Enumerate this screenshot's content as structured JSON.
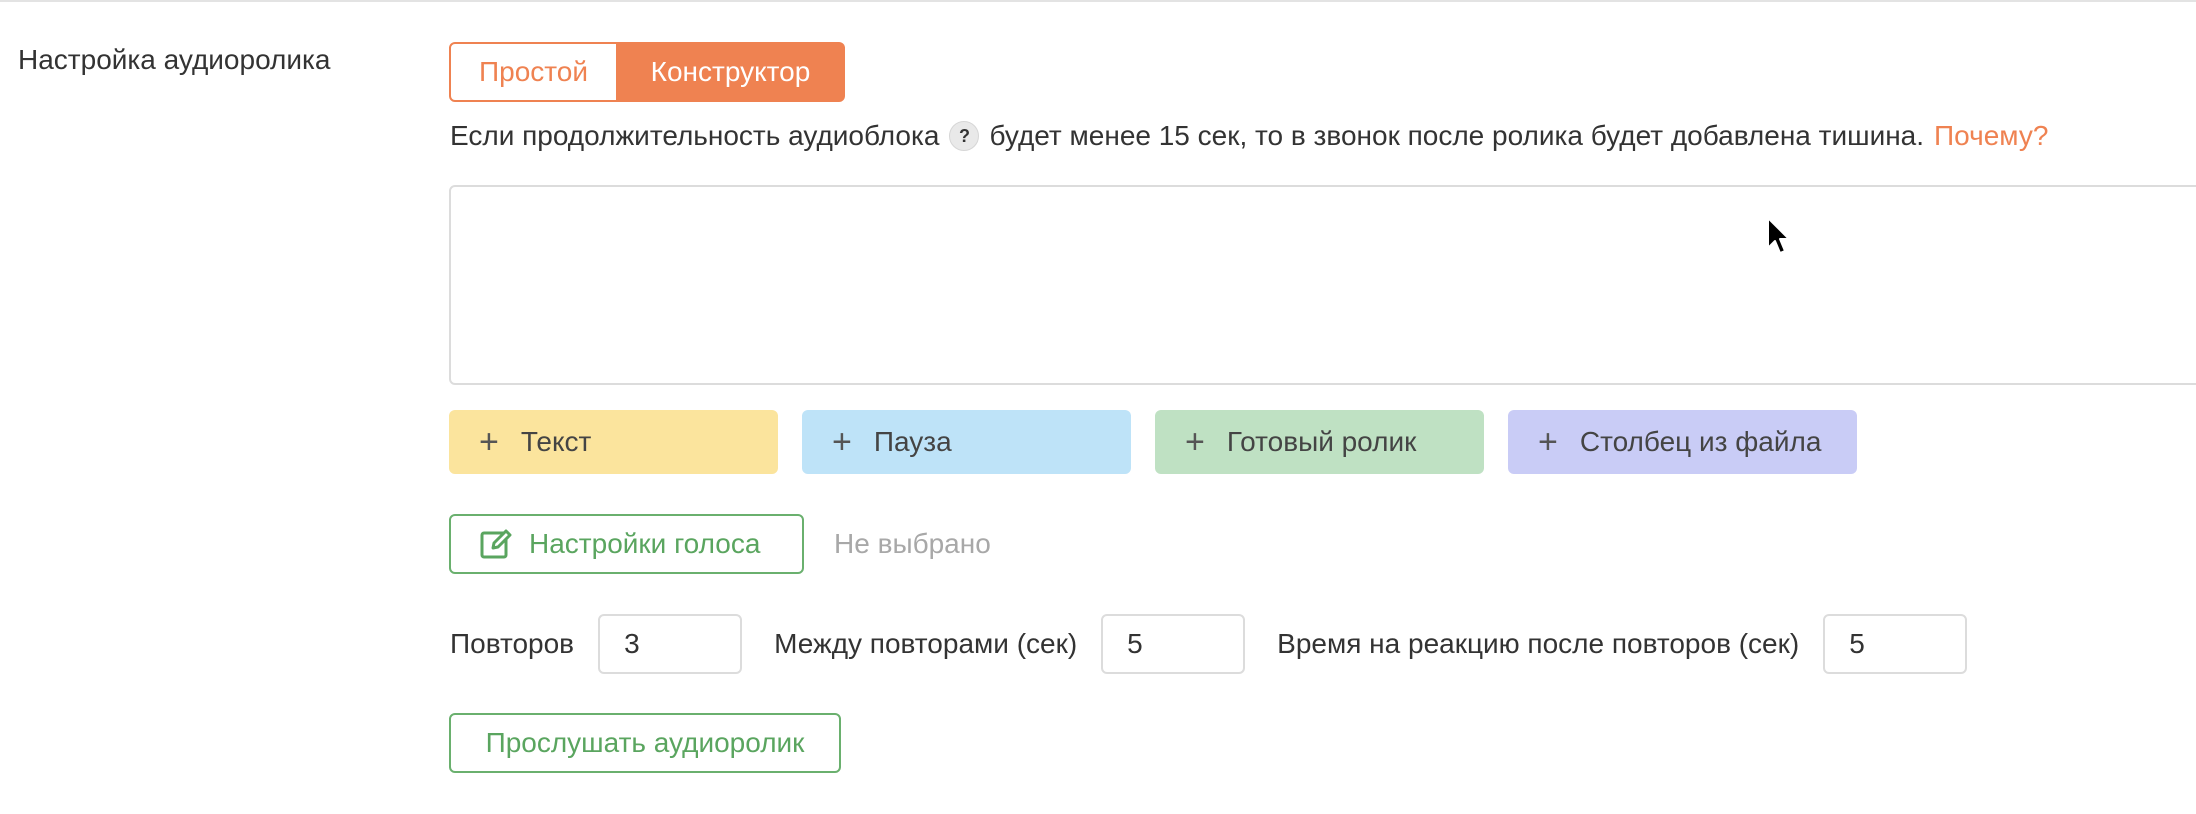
{
  "section": {
    "label": "Настройка аудиоролика"
  },
  "mode_switch": {
    "simple_label": "Простой",
    "constructor_label": "Конструктор",
    "selected": "constructor"
  },
  "hint": {
    "before": "Если продолжительность аудиоблока",
    "help_glyph": "?",
    "after": "будет менее 15 сек, то в звонок после ролика будет добавлена тишина.",
    "link": "Почему?"
  },
  "add_buttons": {
    "text_label": "Текст",
    "pause_label": "Пауза",
    "clip_label": "Готовый ролик",
    "column_label": "Столбец из файла",
    "plus_glyph": "+"
  },
  "voice": {
    "button_label": "Настройки голоса",
    "status": "Не выбрано"
  },
  "repeats": {
    "count_label": "Повторов",
    "count_value": "3",
    "between_label": "Между повторами (сек)",
    "between_value": "5",
    "reaction_label": "Время на реакцию после повторов (сек)",
    "reaction_value": "5"
  },
  "listen": {
    "button_label": "Прослушать аудиоролик"
  },
  "colors": {
    "accent": "#ef8251",
    "green": "#5aa55f",
    "text_yellow": "#fbe49d",
    "pause_blue": "#bee3f8",
    "clip_green": "#bfe1c3",
    "column_violet": "#c9ccf6"
  }
}
